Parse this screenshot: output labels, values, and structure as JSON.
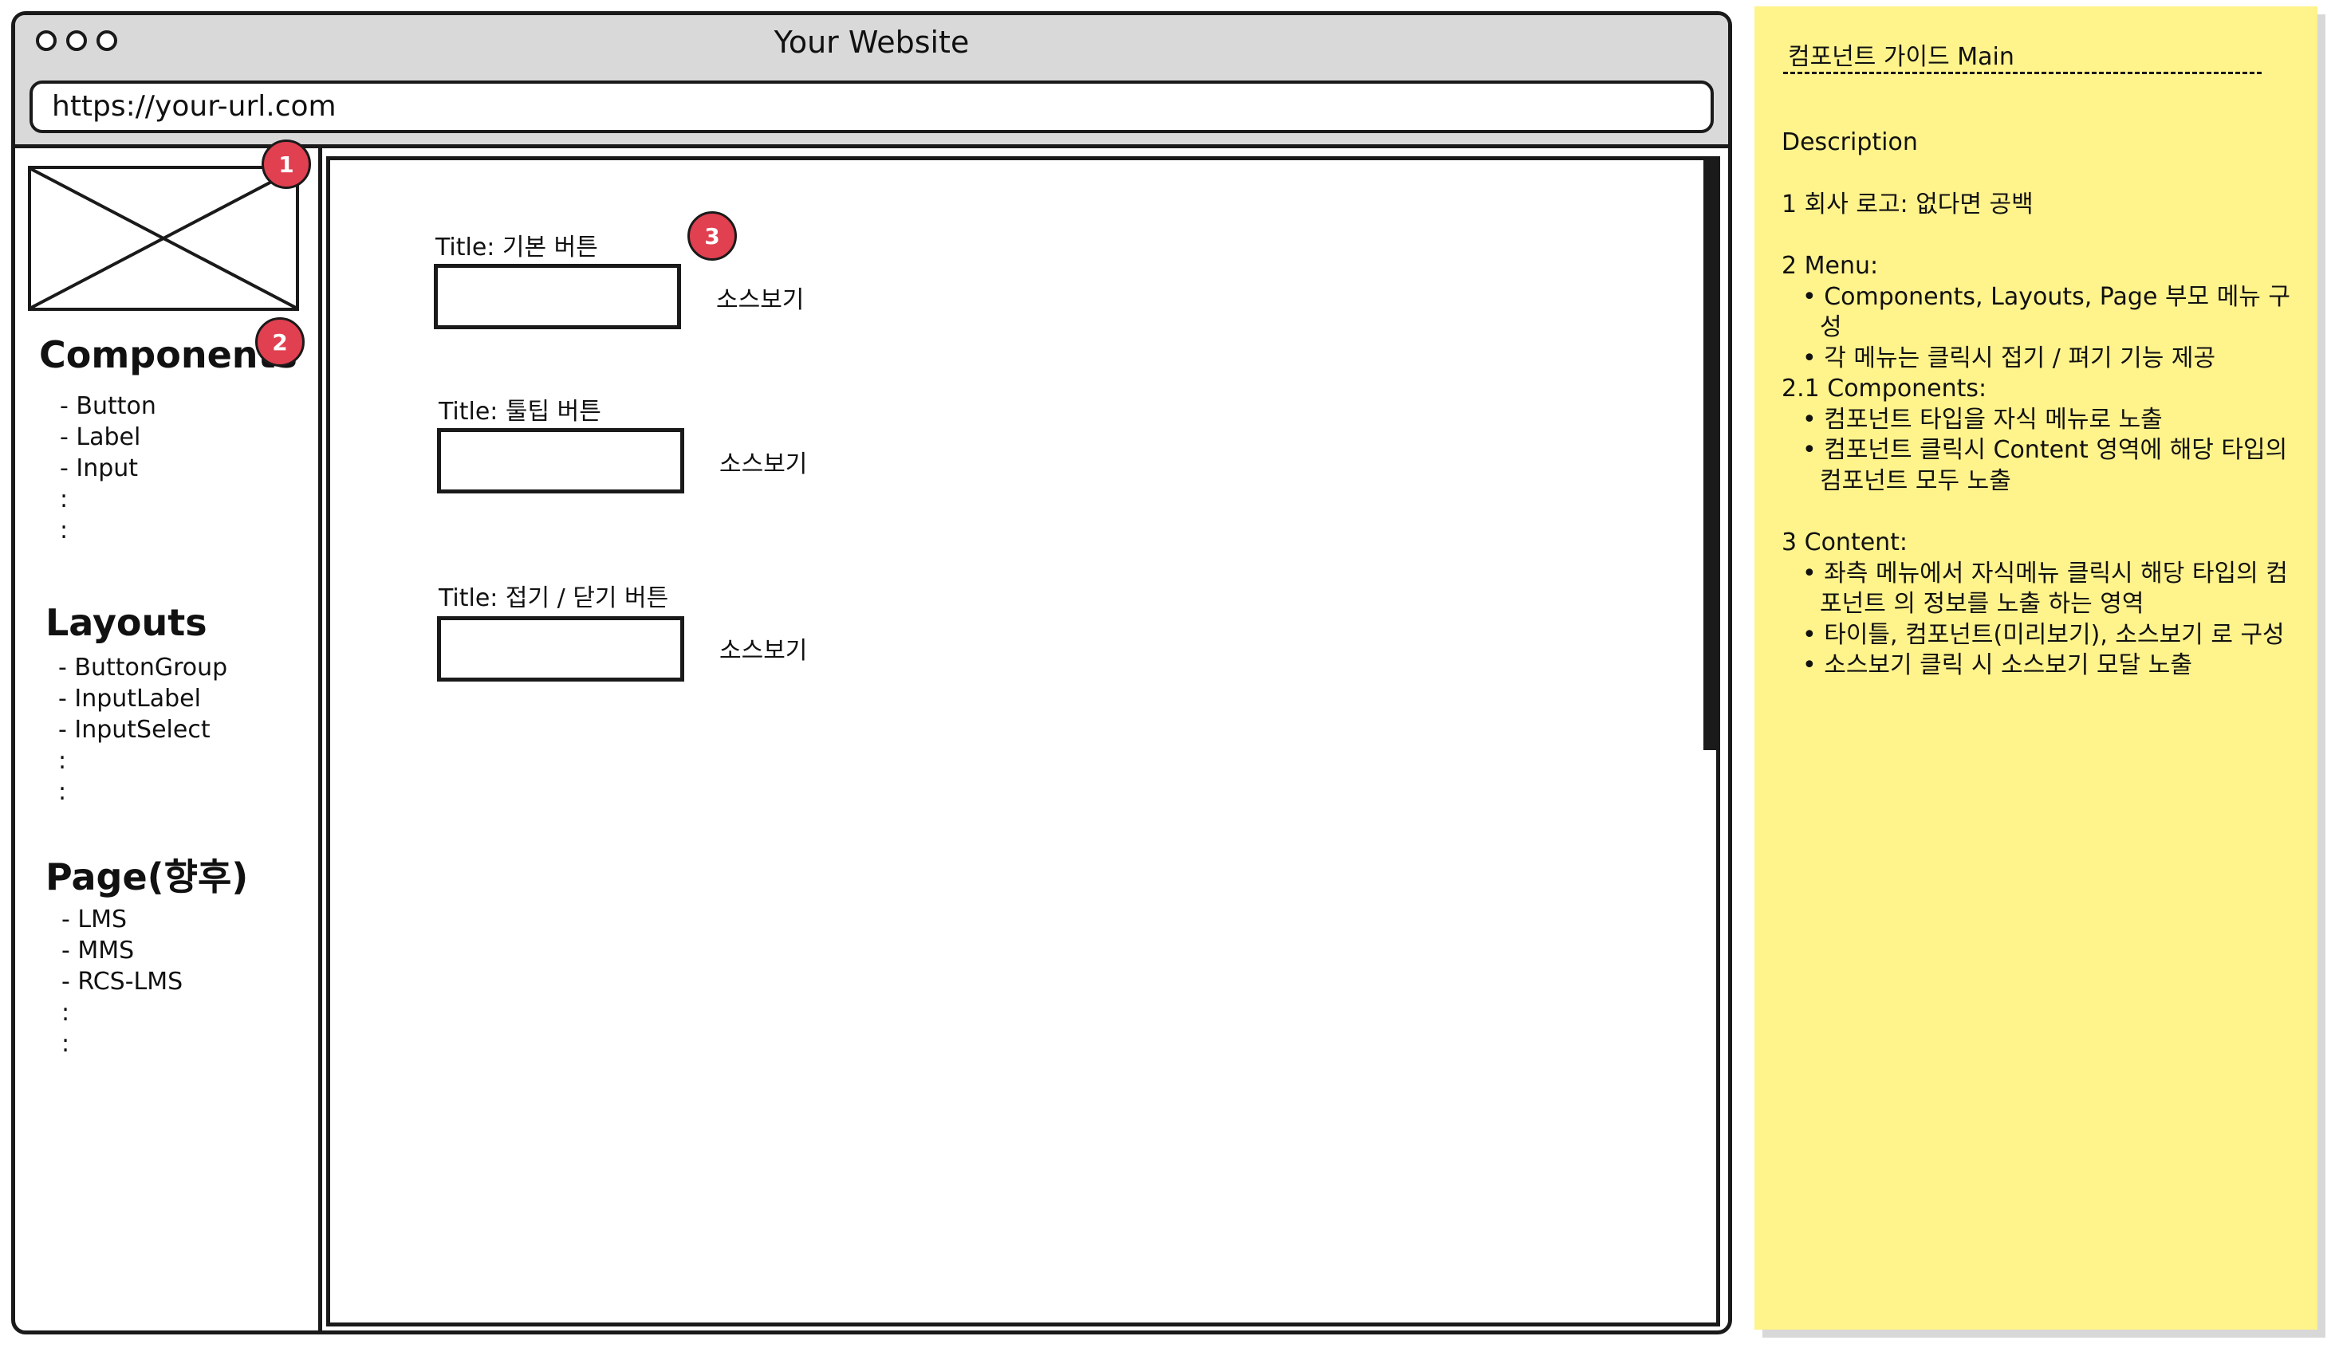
{
  "window": {
    "title": "Your Website",
    "url": "https://your-url.com"
  },
  "sidebar": {
    "sections": [
      {
        "heading": "Components",
        "items": [
          "- Button",
          "- Label",
          "- Input",
          ":",
          ":"
        ]
      },
      {
        "heading": "Layouts",
        "items": [
          "- ButtonGroup",
          "- InputLabel",
          "- InputSelect",
          ":",
          ":"
        ]
      },
      {
        "heading": "Page(향후)",
        "items": [
          "- LMS",
          "- MMS",
          "- RCS-LMS",
          ":",
          ":"
        ]
      }
    ]
  },
  "content": {
    "demos": [
      {
        "title": "Title: 기본 버튼",
        "source_label": "소스보기"
      },
      {
        "title": "Title:  툴팁 버튼",
        "source_label": "소스보기"
      },
      {
        "title": "Title: 접기 / 닫기 버튼",
        "source_label": "소스보기"
      }
    ]
  },
  "badges": [
    "1",
    "2",
    "3"
  ],
  "note": {
    "title": "컴포넌트 가이드 Main",
    "rule": "------------------------------------------------",
    "heading": "Description",
    "line_logo": "1 회사 로고: 없다면 공백",
    "menu_heading": "2 Menu:",
    "menu_bullets": [
      "Components, Layouts, Page 부모 메뉴 구성",
      "각 메뉴는 클릭시 접기 / 펴기 기능 제공"
    ],
    "components_heading": "2.1 Components:",
    "components_bullets": [
      "컴포넌트 타입을 자식 메뉴로 노출",
      "컴포넌트 클릭시 Content 영역에 해당 타입의 컴포넌트 모두 노출"
    ],
    "content_heading": "3 Content:",
    "content_bullets": [
      "좌측 메뉴에서 자식메뉴 클릭시 해당 타입의 컴포넌트 의 정보를 노출 하는 영역",
      "타이틀, 컴포넌트(미리보기), 소스보기 로 구성",
      "소스보기 클릭 시 소스보기 모달 노출"
    ]
  }
}
